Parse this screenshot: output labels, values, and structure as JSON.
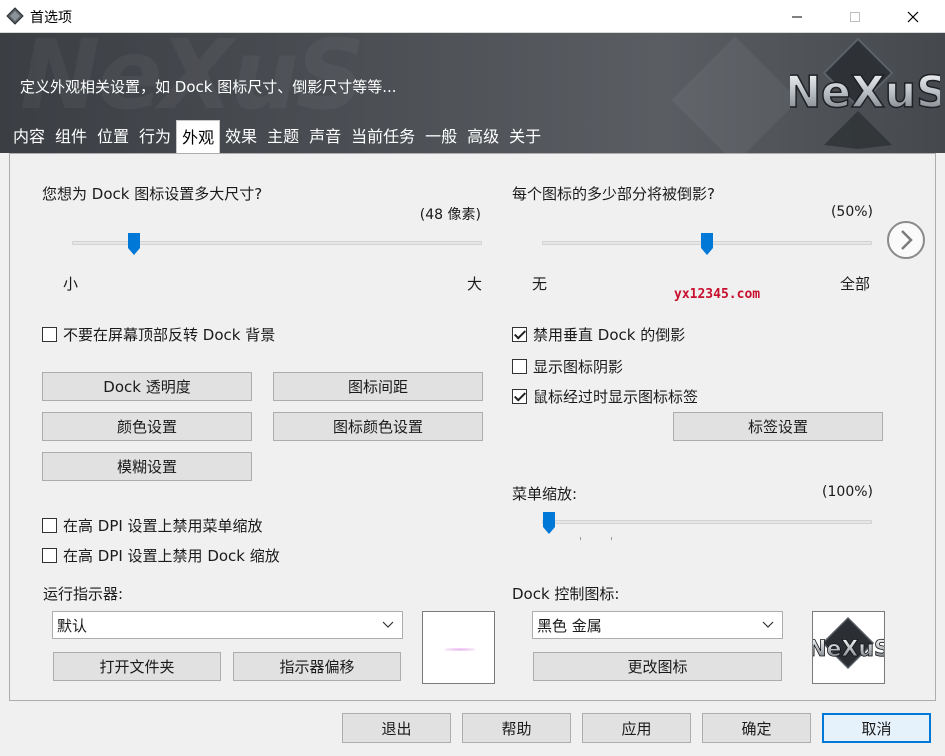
{
  "window": {
    "title": "首选项"
  },
  "banner": {
    "description": "定义外观相关设置，如 Dock 图标尺寸、倒影尺寸等等..."
  },
  "tabs": [
    {
      "label": "内容",
      "active": false
    },
    {
      "label": "组件",
      "active": false
    },
    {
      "label": "位置",
      "active": false
    },
    {
      "label": "行为",
      "active": false
    },
    {
      "label": "外观",
      "active": true
    },
    {
      "label": "效果",
      "active": false
    },
    {
      "label": "主题",
      "active": false
    },
    {
      "label": "声音",
      "active": false
    },
    {
      "label": "当前任务",
      "active": false
    },
    {
      "label": "一般",
      "active": false
    },
    {
      "label": "高级",
      "active": false
    },
    {
      "label": "关于",
      "active": false
    }
  ],
  "icon_size": {
    "question": "您想为 Dock 图标设置多大尺寸?",
    "value_text": "(48 像素)",
    "min_label": "小",
    "max_label": "大",
    "fraction": 0.15
  },
  "reflection": {
    "question": "每个图标的多少部分将被倒影?",
    "value_text": "(50%)",
    "min_label": "无",
    "max_label": "全部",
    "fraction": 0.5
  },
  "watermark": "yx12345.com",
  "checkboxes": {
    "no_flip_top": {
      "label": "不要在屏幕顶部反转 Dock 背景",
      "checked": false
    },
    "disable_vertical_reflection": {
      "label": "禁用垂直 Dock 的倒影",
      "checked": true
    },
    "show_icon_shadow": {
      "label": "显示图标阴影",
      "checked": false
    },
    "show_label_on_hover": {
      "label": "鼠标经过时显示图标标签",
      "checked": true
    },
    "disable_menu_scaling_hidpi": {
      "label": "在高 DPI 设置上禁用菜单缩放",
      "checked": false
    },
    "disable_dock_scaling_hidpi": {
      "label": "在高 DPI 设置上禁用 Dock 缩放",
      "checked": false
    }
  },
  "buttons": {
    "dock_transparency": "Dock 透明度",
    "icon_spacing": "图标间距",
    "color_settings": "颜色设置",
    "icon_color_settings": "图标颜色设置",
    "blur_settings": "模糊设置",
    "label_settings": "标签设置",
    "open_folder": "打开文件夹",
    "indicator_offset": "指示器偏移",
    "change_icon": "更改图标"
  },
  "menu_scale": {
    "label": "菜单缩放:",
    "value_text": "(100%)",
    "fraction": 0.02
  },
  "run_indicator": {
    "label": "运行指示器:",
    "selected": "默认"
  },
  "dock_control_icon": {
    "label": "Dock 控制图标:",
    "selected": "黑色 金属"
  },
  "footer": {
    "exit": "退出",
    "help": "帮助",
    "apply": "应用",
    "ok": "确定",
    "cancel": "取消"
  },
  "logo_text": "NeXuS",
  "colors": {
    "accent": "#0078d7",
    "banner_dark": "#3b3e43",
    "panel_bg": "#f0f0f0",
    "watermark_red": "#c8102e"
  }
}
